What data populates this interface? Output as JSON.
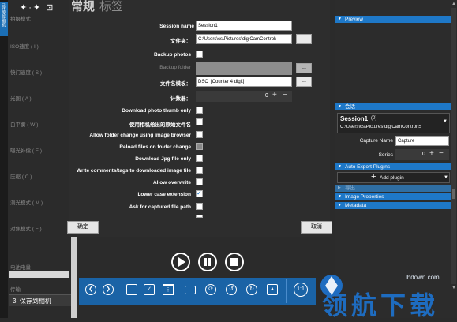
{
  "app": {
    "left_vertical_tab": "已经保存相机"
  },
  "left_settings": [
    "拍摄模式",
    "ISO速度 ( I )",
    "快门速度 ( S )",
    "光圈 ( A )",
    "白平衡 ( W )",
    "曝光补偿 ( E )",
    "压缩 ( C )",
    "测光模式 ( M )",
    "对焦模式 ( F )"
  ],
  "left_bottom": {
    "battery_label": "电池电量",
    "transfer_label": "传输",
    "save_target": "3. 保存到相机"
  },
  "dialog": {
    "title_main": "常规",
    "title_sub": "标签",
    "fields": {
      "session_name_label": "Session name",
      "session_name_value": "Session1",
      "folder_label": "文件夹：",
      "folder_value": "C:\\Users\\cs\\Pictures\\digiCamControl\\",
      "folder_browse": "...",
      "backup_photos_label": "Backup photos",
      "backup_folder_label": "Backup folder",
      "backup_folder_browse": "...",
      "file_template_label": "文件名模板：",
      "file_template_value": "DSC_[Counter 4 digit]",
      "file_template_browse": "...",
      "counter_label": "计数器：",
      "counter_value": "0",
      "counter_plus": "+",
      "counter_minus": "−"
    },
    "options": [
      {
        "label": "Download photo thumb only",
        "checked": false,
        "dim": false
      },
      {
        "label": "使用相机给出的原始文件名",
        "checked": false,
        "dim": false
      },
      {
        "label": "Allow folder change using image browser",
        "checked": false,
        "dim": false
      },
      {
        "label": "Reload files on folder change",
        "checked": false,
        "dim": true
      },
      {
        "label": "Download Jpg file only",
        "checked": false,
        "dim": false
      },
      {
        "label": "Write comments/tags to downloaded image file",
        "checked": false,
        "dim": false
      },
      {
        "label": "Allow overwrite",
        "checked": false,
        "dim": false
      },
      {
        "label": "Lower case extension",
        "checked": true,
        "dim": false
      },
      {
        "label": "Ask for captured file path",
        "checked": false,
        "dim": false
      }
    ],
    "ok_button": "确定",
    "cancel_button": "取消"
  },
  "right_panel": {
    "preview_header": "Preview",
    "session_header": "会话",
    "session_name": "Session1",
    "session_count": "(0)",
    "session_path": "C:\\Users\\cs\\Pictures\\digiCamControl\\S",
    "capture_name_label": "Capture Name",
    "capture_name_value": "Capture",
    "series_label": "Series",
    "series_value": "0",
    "series_plus": "+",
    "series_minus": "−",
    "auto_export_header": "Auto Export Plugins",
    "add_plugin_label": "Add plugin",
    "add_plugin_plus": "+",
    "dim_header": "导出",
    "image_properties_header": "Image Properties",
    "metadata_header": "Metadata"
  },
  "toolbar": {
    "zoom_label": "1:1",
    "icons": [
      "prev-icon",
      "next-icon",
      "select-all-icon",
      "check-icon",
      "delete-icon",
      "folder-icon",
      "sync-icon",
      "rotate-left-icon",
      "rotate-right-icon",
      "image-icon",
      "zoom-icon"
    ]
  },
  "player": {
    "icons": [
      "play-icon",
      "pause-icon",
      "stop-icon"
    ]
  },
  "watermark": {
    "text": "领航下载",
    "url": "lhdown.com"
  },
  "colors": {
    "accent": "#1e78c8",
    "toolbar": "#1a63a6",
    "background": "#2b2b2b",
    "watermark": "#1e6cc0"
  }
}
